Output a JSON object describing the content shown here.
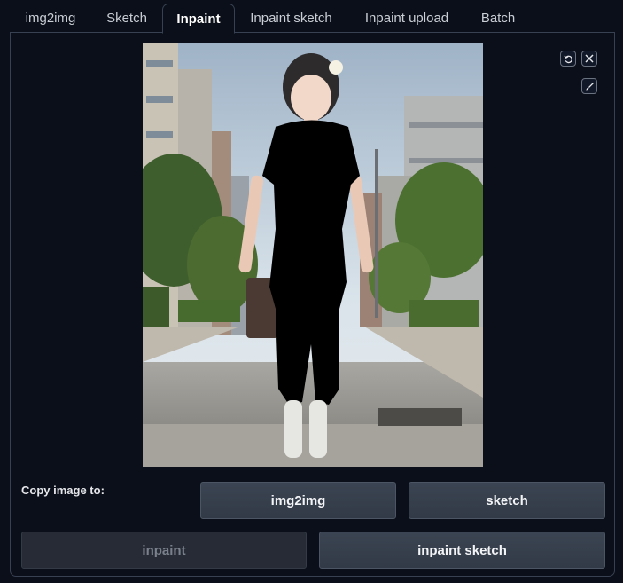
{
  "tabs": [
    {
      "label": "img2img"
    },
    {
      "label": "Sketch"
    },
    {
      "label": "Inpaint"
    },
    {
      "label": "Inpaint sketch"
    },
    {
      "label": "Inpaint upload"
    },
    {
      "label": "Batch"
    }
  ],
  "active_tab": "Inpaint",
  "image": {
    "icons": [
      "undo-icon",
      "close-icon",
      "brush-icon"
    ]
  },
  "copy": {
    "label": "Copy image to:",
    "img2img": "img2img",
    "sketch": "sketch",
    "inpaint": "inpaint",
    "inpaint_sketch": "inpaint sketch"
  }
}
